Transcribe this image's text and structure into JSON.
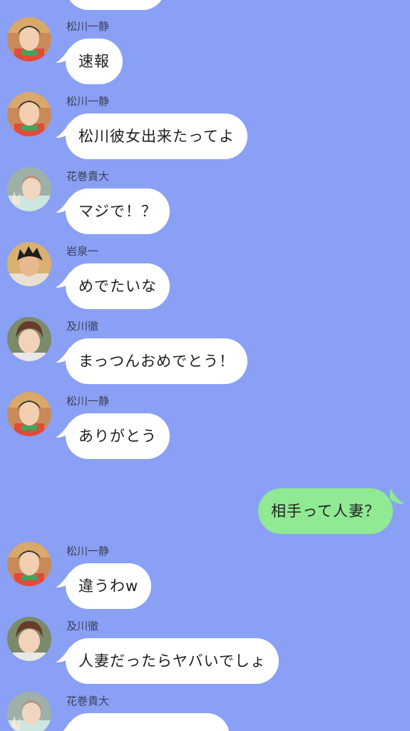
{
  "colors": {
    "background": "#8aa0f5",
    "incoming_bubble": "#ffffff",
    "outgoing_bubble": "#90e993",
    "name_text": "#3b3f55"
  },
  "messages": [
    {
      "sender": "松川一静",
      "text": "速報",
      "avatar": "matsukawa-avatar-icon"
    },
    {
      "sender": "松川一静",
      "text": "松川彼女出来たってよ",
      "avatar": "matsukawa-avatar-icon"
    },
    {
      "sender": "花巻貴大",
      "text": "マジで！？",
      "avatar": "hanamaki-avatar-icon"
    },
    {
      "sender": "岩泉一",
      "text": "めでたいな",
      "avatar": "iwaizumi-avatar-icon"
    },
    {
      "sender": "及川徹",
      "text": "まっつんおめでとう！",
      "avatar": "oikawa-avatar-icon"
    },
    {
      "sender": "松川一静",
      "text": "ありがとう",
      "avatar": "matsukawa-avatar-icon"
    },
    {
      "sender": "",
      "text": "相手って人妻？",
      "outgoing": true
    },
    {
      "sender": "松川一静",
      "text": "違うわw",
      "avatar": "matsukawa-avatar-icon"
    },
    {
      "sender": "及川徹",
      "text": "人妻だったらヤバいでしょ",
      "avatar": "oikawa-avatar-icon"
    },
    {
      "sender": "花巻貴大",
      "text": "",
      "avatar": "hanamaki-avatar-icon"
    }
  ]
}
